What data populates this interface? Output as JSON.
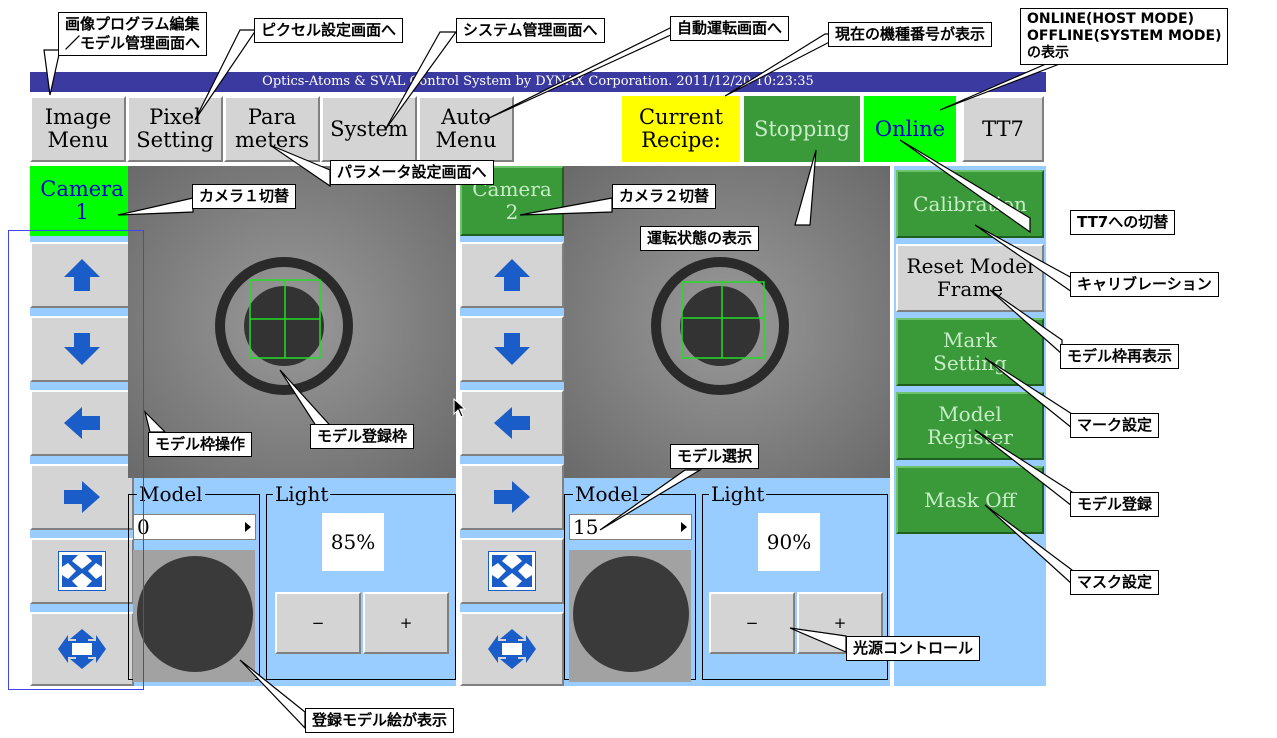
{
  "title_bar": "Optics-Atoms & SVAL Control System by DYNAX Corporation. 2011/12/20 10:23:35",
  "toolbar": {
    "image_menu": "Image\nMenu",
    "pixel_setting": "Pixel\nSetting",
    "parameters": "Para\nmeters",
    "system": "System",
    "auto_menu": "Auto\nMenu",
    "current_recipe": "Current\nRecipe:",
    "run_state": "Stopping",
    "online": "Online",
    "tt7": "TT7"
  },
  "camera1": {
    "label": "Camera\n1",
    "model_group": "Model",
    "model_value": "0",
    "light_group": "Light",
    "light_value": "85%",
    "minus": "−",
    "plus": "+"
  },
  "camera2": {
    "label": "Camera\n2",
    "model_group": "Model",
    "model_value": "15",
    "light_group": "Light",
    "light_value": "90%",
    "minus": "−",
    "plus": "+"
  },
  "right": {
    "calibration": "Calibration",
    "reset_model_frame": "Reset Model\nFrame",
    "mark_setting": "Mark\nSetting",
    "model_register": "Model\nRegister",
    "mask_off": "Mask Off"
  },
  "callouts": {
    "image_menu": "画像プログラム編集\n／モデル管理画面へ",
    "pixel": "ピクセル設定画面へ",
    "system": "システム管理画面へ",
    "auto": "自動運転画面へ",
    "recipe": "現在の機種番号が表示",
    "online": "ONLINE(HOST MODE)\nOFFLINE(SYSTEM MODE)\nの表示",
    "params": "パラメータ設定画面へ",
    "cam1": "カメラ１切替",
    "cam2": "カメラ２切替",
    "run_state": "運転状態の表示",
    "tt7": "TT7への切替",
    "calib": "キャリブレーション",
    "reset": "モデル枠再表示",
    "mark": "マーク設定",
    "register": "モデル登録",
    "mask": "マスク設定",
    "frame_op": "モデル枠操作",
    "model_frame": "モデル登録枠",
    "model_select": "モデル選択",
    "light_control": "光源コントロール",
    "thumb": "登録モデル絵が表示"
  },
  "colors": {
    "title_bar": "#3a3aa0",
    "panel": "#99ccff",
    "green": "#3a9a3a",
    "bright_green": "#00ff00",
    "yellow": "#ffff00",
    "arrow_blue": "#1a5cc8"
  }
}
